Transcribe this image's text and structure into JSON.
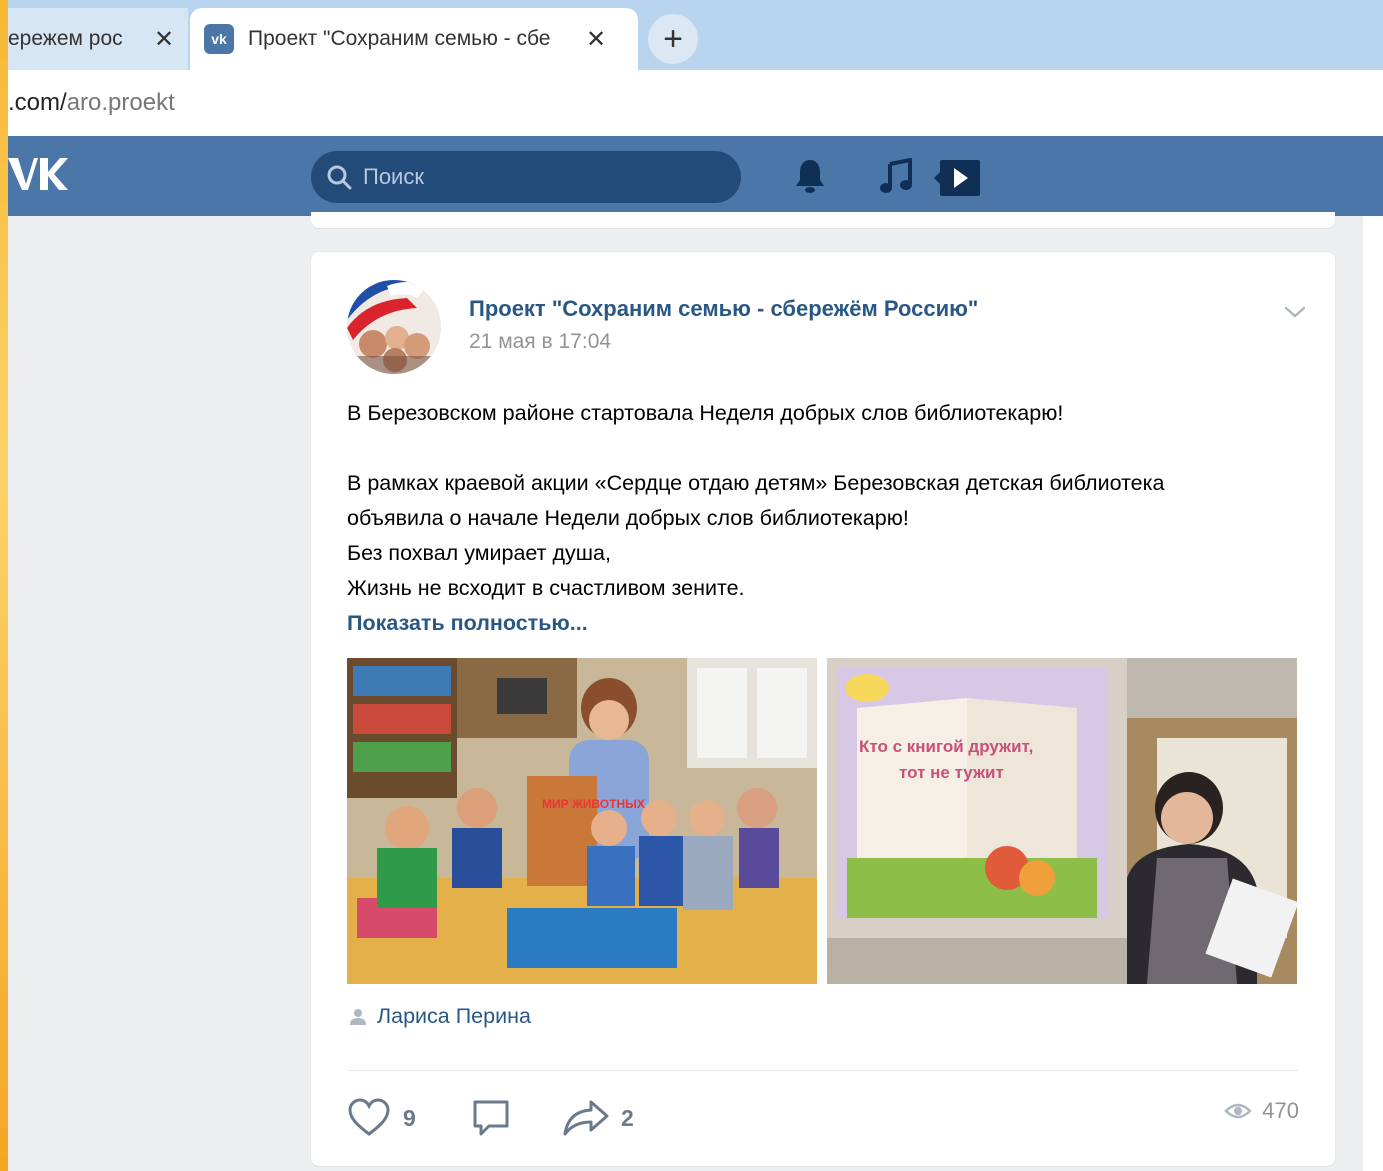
{
  "browser": {
    "tabs": [
      {
        "title": "ережем рос",
        "close": "✕"
      },
      {
        "title": "Проект \"Сохраним семью - сбе",
        "favicon": "vk",
        "close": "✕"
      }
    ],
    "new_tab": "+",
    "url_prefix": ".com/",
    "url_path": "aro.proekt"
  },
  "header": {
    "logo": "\u0001K",
    "search_placeholder": "Поиск",
    "icons": [
      "bell-icon",
      "music-icon",
      "video-icon"
    ]
  },
  "post": {
    "author": "Проект \"Сохраним семью - сбережём Россию\"",
    "date": "21 мая в 17:04",
    "lines": [
      "В Березовском районе стартовала Неделя добрых слов библиотекарю!",
      "",
      "В рамках краевой акции «Сердце отдаю детям» Березовская детская библиотека",
      "объявила о начале Недели добрых слов библиотекарю!",
      "Без похвал умирает душа,",
      "Жизнь не всходит в счастливом зените."
    ],
    "show_more": "Показать полностью...",
    "photo1_caption": "МИР ЖИВОТНЫХ",
    "photo2_caption_line1": "Кто с книгой дружит,",
    "photo2_caption_line2": "тот не тужит",
    "signer": "Лариса Перина",
    "likes": "9",
    "shares": "2",
    "views": "470"
  },
  "colors": {
    "vk_blue": "#4a76a8",
    "search_bg": "#224b7a",
    "link": "#2a5885",
    "outer_frame": "#f7b733"
  }
}
